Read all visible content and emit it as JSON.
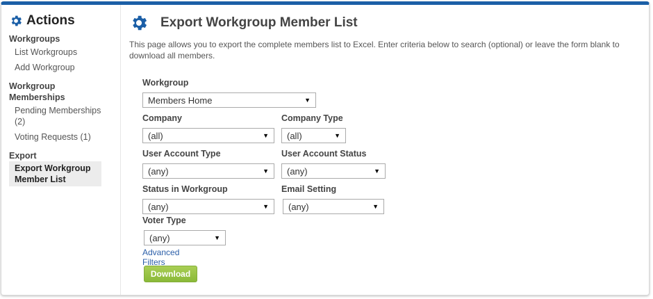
{
  "sidebar": {
    "title": "Actions",
    "groups": [
      {
        "heading": "Workgroups",
        "items": [
          "List Workgroups",
          "Add Workgroup"
        ]
      },
      {
        "heading": "Workgroup Memberships",
        "items": [
          "Pending Memberships (2)",
          "Voting Requests (1)"
        ]
      },
      {
        "heading": "Export",
        "items": [
          "Export Workgroup Member List"
        ]
      }
    ]
  },
  "main": {
    "title": "Export Workgroup Member List",
    "intro": "This page allows you to export the complete members list to Excel. Enter criteria below to search (optional) or leave the form blank to download all members.",
    "fields": {
      "workgroup": {
        "label": "Workgroup",
        "value": "Members Home"
      },
      "company": {
        "label": "Company",
        "value": "(all)"
      },
      "company_type": {
        "label": "Company Type",
        "value": "(all)"
      },
      "user_account_type": {
        "label": "User Account Type",
        "value": "(any)"
      },
      "user_account_status": {
        "label": "User Account Status",
        "value": "(any)"
      },
      "status_in_workgroup": {
        "label": "Status in Workgroup",
        "value": "(any)"
      },
      "email_setting": {
        "label": "Email Setting",
        "value": "(any)"
      },
      "voter_type": {
        "label": "Voter Type",
        "value": "(any)"
      }
    },
    "advanced_filters": "Advanced Filters",
    "download": "Download"
  },
  "colors": {
    "accent": "#1b5fa7",
    "link": "#2a5ea8",
    "button": "#98c646"
  },
  "icons": {
    "section": "gear-icon",
    "dropdown": "caret-down-icon"
  }
}
